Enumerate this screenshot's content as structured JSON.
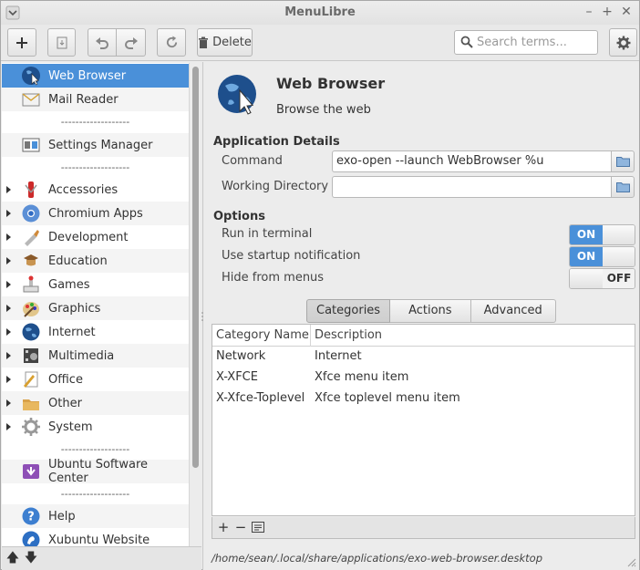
{
  "window": {
    "title": "MenuLibre"
  },
  "toolbar": {
    "delete_label": "Delete",
    "search_placeholder": "Search terms..."
  },
  "sidebar": {
    "items": [
      {
        "type": "item",
        "label": "Web Browser",
        "icon": "web-browser-globe-icon",
        "selected": true,
        "expandable": false
      },
      {
        "type": "item",
        "label": "Mail Reader",
        "icon": "mail-reader-icon",
        "expandable": false
      },
      {
        "type": "separator",
        "label": "-------------------"
      },
      {
        "type": "item",
        "label": "Settings Manager",
        "icon": "settings-manager-icon",
        "expandable": false
      },
      {
        "type": "separator",
        "label": "-------------------"
      },
      {
        "type": "item",
        "label": "Accessories",
        "icon": "accessories-icon",
        "expandable": true
      },
      {
        "type": "item",
        "label": "Chromium Apps",
        "icon": "chromium-icon",
        "expandable": true
      },
      {
        "type": "item",
        "label": "Development",
        "icon": "development-icon",
        "expandable": true
      },
      {
        "type": "item",
        "label": "Education",
        "icon": "education-icon",
        "expandable": true
      },
      {
        "type": "item",
        "label": "Games",
        "icon": "games-icon",
        "expandable": true
      },
      {
        "type": "item",
        "label": "Graphics",
        "icon": "graphics-icon",
        "expandable": true
      },
      {
        "type": "item",
        "label": "Internet",
        "icon": "internet-icon",
        "expandable": true
      },
      {
        "type": "item",
        "label": "Multimedia",
        "icon": "multimedia-icon",
        "expandable": true
      },
      {
        "type": "item",
        "label": "Office",
        "icon": "office-icon",
        "expandable": true
      },
      {
        "type": "item",
        "label": "Other",
        "icon": "other-icon",
        "expandable": true
      },
      {
        "type": "item",
        "label": "System",
        "icon": "system-icon",
        "expandable": true
      },
      {
        "type": "separator",
        "label": "-------------------"
      },
      {
        "type": "item",
        "label": "Ubuntu Software Center",
        "icon": "software-center-icon",
        "expandable": false
      },
      {
        "type": "separator",
        "label": "-------------------"
      },
      {
        "type": "item",
        "label": "Help",
        "icon": "help-icon",
        "expandable": false
      },
      {
        "type": "item",
        "label": "Xubuntu Website",
        "icon": "xubuntu-icon",
        "expandable": false
      }
    ]
  },
  "app": {
    "name": "Web Browser",
    "comment": "Browse the web"
  },
  "details": {
    "heading": "Application Details",
    "command_label": "Command",
    "command_value": "exo-open --launch WebBrowser %u",
    "workdir_label": "Working Directory",
    "workdir_value": ""
  },
  "options": {
    "heading": "Options",
    "run_in_terminal_label": "Run in terminal",
    "run_in_terminal_state": "ON",
    "startup_notify_label": "Use startup notification",
    "startup_notify_state": "ON",
    "hide_label": "Hide from menus",
    "hide_state": "OFF"
  },
  "tabs": [
    "Categories",
    "Actions",
    "Advanced"
  ],
  "categories_table": {
    "columns": [
      "Category Name",
      "Description"
    ],
    "rows": [
      [
        "Network",
        "Internet"
      ],
      [
        "X-XFCE",
        "Xfce menu item"
      ],
      [
        "X-Xfce-Toplevel",
        "Xfce toplevel menu item"
      ]
    ]
  },
  "status": {
    "filepath": "/home/sean/.local/share/applications/exo-web-browser.desktop"
  },
  "colors": {
    "accent": "#4a90d9",
    "selected_text": "#ffffff"
  }
}
